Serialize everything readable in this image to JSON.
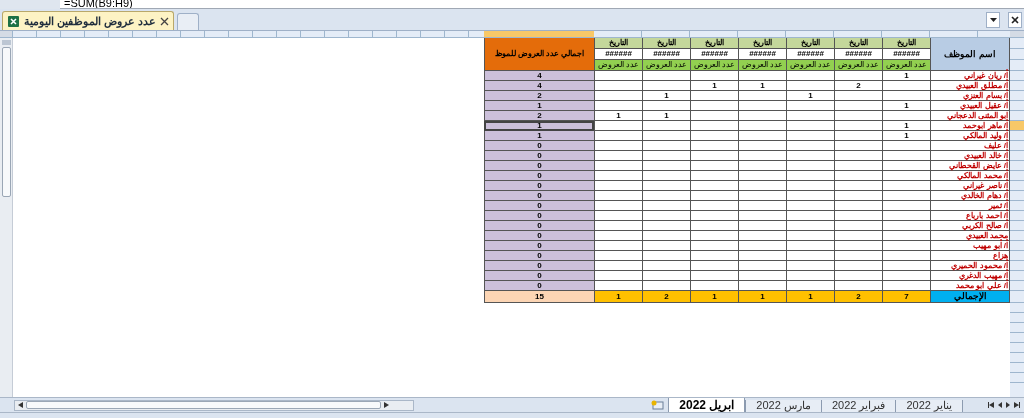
{
  "formula_bar": {
    "formula": "=SUM(B9:H9)"
  },
  "document_tab": {
    "title": "عدد عروض الموظفين اليومية"
  },
  "sheet": {
    "name_header": "اسم الموظف",
    "total_header": "اجمالي عدد العروض للموظ",
    "date_columns": [
      {
        "date_label": "التاريخ",
        "date_value": "######",
        "count_label": "عدد العروض",
        "total": "7"
      },
      {
        "date_label": "التاريخ",
        "date_value": "######",
        "count_label": "عدد العروض",
        "total": "2"
      },
      {
        "date_label": "التاريخ",
        "date_value": "######",
        "count_label": "عدد العروض",
        "total": "1"
      },
      {
        "date_label": "التاريخ",
        "date_value": "######",
        "count_label": "عدد العروض",
        "total": "1"
      },
      {
        "date_label": "التاريخ",
        "date_value": "######",
        "count_label": "عدد العروض",
        "total": "1"
      },
      {
        "date_label": "التاريخ",
        "date_value": "######",
        "count_label": "عدد العروض",
        "total": "2"
      },
      {
        "date_label": "التاريخ",
        "date_value": "######",
        "count_label": "عدد العروض",
        "total": "1"
      }
    ],
    "rows": [
      {
        "name": "أ/ ريان غيراني",
        "counts": {
          "column_1": "1"
        },
        "total": "4",
        "selected": false
      },
      {
        "name": "أ/ مطلق العبيدي",
        "counts": {
          "column_2": "2",
          "column_4": "1",
          "column_5": "1"
        },
        "total": "4",
        "selected": false
      },
      {
        "name": "أ/ بسام العنزي",
        "counts": {
          "column_3": "1",
          "column_6": "1"
        },
        "total": "2",
        "selected": false
      },
      {
        "name": "أ/ عقيل العبيدي",
        "counts": {
          "column_1": "1"
        },
        "total": "1",
        "selected": false
      },
      {
        "name": "ابو المثنى الدعجاني",
        "counts": {
          "column_6": "1",
          "column_7": "1"
        },
        "total": "2",
        "selected": false
      },
      {
        "name": "أ/ ماهر ابوحمد",
        "counts": {
          "column_1": "1"
        },
        "total": "1",
        "selected": true
      },
      {
        "name": "أ/ وليد المالكي",
        "counts": {
          "column_1": "1"
        },
        "total": "1",
        "selected": false
      },
      {
        "name": "أ/ عليف",
        "total": "0",
        "selected": false
      },
      {
        "name": "أ/ خالد العبيدي",
        "total": "0",
        "selected": false
      },
      {
        "name": "أ/ عايض القحطاني",
        "total": "0",
        "selected": false
      },
      {
        "name": "أ/ محمد المالكي",
        "total": "0",
        "selected": false
      },
      {
        "name": "أ/ ناصر غيراني",
        "total": "0",
        "selected": false
      },
      {
        "name": "أ/ دهام الخالدي",
        "total": "0",
        "selected": false
      },
      {
        "name": "أ/ ثمير",
        "total": "0",
        "selected": false
      },
      {
        "name": "أ/  احمد بارباع",
        "total": "0",
        "selected": false
      },
      {
        "name": "أ/ صالح الكربي",
        "total": "0",
        "selected": false
      },
      {
        "name": "محمد العبيدي",
        "total": "0",
        "selected": false
      },
      {
        "name": "أ/ أبو مهيب",
        "total": "0",
        "selected": false
      },
      {
        "name": "هزاع",
        "total": "0",
        "selected": false
      },
      {
        "name": "أ/ محمود الحميري",
        "total": "0",
        "selected": false
      },
      {
        "name": "أ/ مهيب الدغري",
        "total": "0",
        "selected": false
      },
      {
        "name": "أ/ علي ابو محمد",
        "total": "0",
        "selected": false
      }
    ],
    "footer_label": "الإجمالي",
    "grand_total": "15"
  },
  "sheet_tabs": [
    {
      "label": "يناير 2022",
      "selected": false
    },
    {
      "label": "فبراير 2022",
      "selected": false
    },
    {
      "label": "مارس 2022",
      "selected": false
    },
    {
      "label": "ابريل 2022",
      "selected": true
    }
  ]
}
